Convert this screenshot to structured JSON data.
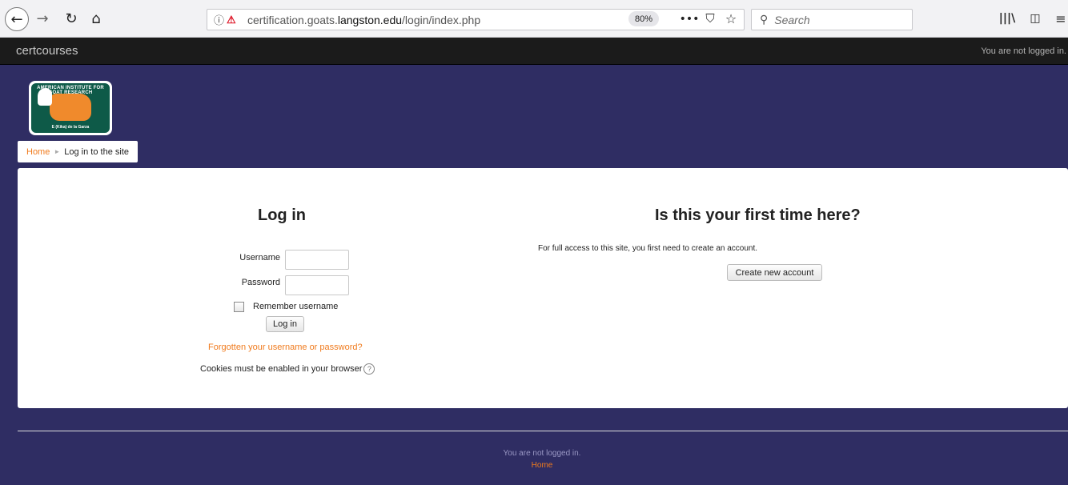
{
  "browser": {
    "back_icon": "back-arrow-icon",
    "back_glyph": "←",
    "forward_glyph": "→",
    "reload_glyph": "↻",
    "home_glyph": "⌂",
    "url_prefix": "certification.goats.",
    "url_domain": "langston.edu",
    "url_path": "/login/index.php",
    "zoom": "80%",
    "more_glyph": "•••",
    "pocket_glyph": "⛉",
    "star_glyph": "☆",
    "search_placeholder": "Search",
    "search_glyph": "⚲",
    "library_glyph": "|||\\",
    "sidebar_glyph": "◫",
    "menu_glyph": "≡"
  },
  "navbar": {
    "brand": "certcourses",
    "login_status": "You are not logged in."
  },
  "header": {
    "logo_top_text": "AMERICAN INSTITUTE FOR GOAT RESEARCH",
    "logo_bottom_text": "E (Kika) de la Garza"
  },
  "breadcrumb": {
    "home": "Home",
    "separator": "►",
    "current": "Log in to the site"
  },
  "login": {
    "heading": "Log in",
    "username_label": "Username",
    "password_label": "Password",
    "remember_label": "Remember username",
    "submit_label": "Log in",
    "forgot_link": "Forgotten your username or password?",
    "cookies_note": "Cookies must be enabled in your browser",
    "help_glyph": "?"
  },
  "signup": {
    "heading": "Is this your first time here?",
    "description": "For full access to this site, you first need to create an account.",
    "create_button": "Create new account"
  },
  "footer": {
    "login_status": "You are not logged in.",
    "home_link": "Home"
  },
  "colors": {
    "page_bg": "#2f2d63",
    "navbar_bg": "#1b1b1b",
    "link": "#f07b1e"
  }
}
